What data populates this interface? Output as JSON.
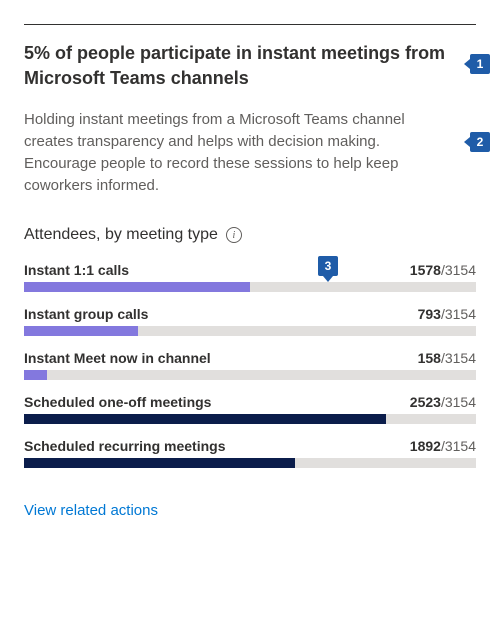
{
  "insight": {
    "title": "5% of people participate in instant meetings from Microsoft Teams channels",
    "description": "Holding instant meetings from a Microsoft Teams channel creates transparency and helps with decision making. Encourage people to record these sessions to help keep coworkers informed."
  },
  "section": {
    "title": "Attendees, by meeting type",
    "info_icon": "info-icon"
  },
  "chart_data": {
    "type": "bar",
    "title": "Attendees, by meeting type",
    "total": 3154,
    "xlabel": "",
    "ylabel": "",
    "series": [
      {
        "name": "Instant 1:1 calls",
        "value": 1578,
        "color": "#8378de"
      },
      {
        "name": "Instant group calls",
        "value": 793,
        "color": "#8378de"
      },
      {
        "name": "Instant Meet now in channel",
        "value": 158,
        "color": "#8378de"
      },
      {
        "name": "Scheduled one-off meetings",
        "value": 2523,
        "color": "#0b1d4b"
      },
      {
        "name": "Scheduled recurring meetings",
        "value": 1892,
        "color": "#0b1d4b"
      }
    ]
  },
  "actions": {
    "view_related": "View related actions"
  },
  "callouts": {
    "c1": "1",
    "c2": "2",
    "c3": "3"
  }
}
